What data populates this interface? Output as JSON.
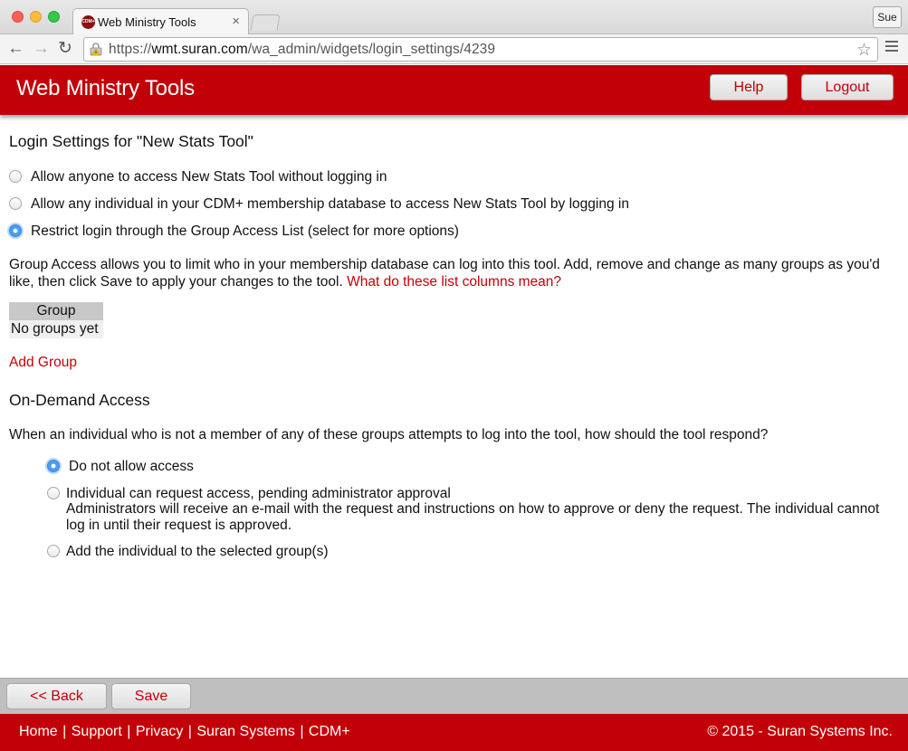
{
  "browser": {
    "tab_title": "Web Ministry Tools",
    "tab_close": "×",
    "favicon_text": "CDM+",
    "profile": "Sue",
    "url_scheme": "https://",
    "url_host": "wmt.suran.com",
    "url_path": "/wa_admin/widgets/login_settings/4239"
  },
  "header": {
    "title": "Web Ministry Tools",
    "help_label": "Help",
    "logout_label": "Logout"
  },
  "page": {
    "heading": "Login Settings for \"New Stats Tool\"",
    "login_options": [
      {
        "label": "Allow anyone to access New Stats Tool without logging in",
        "checked": false
      },
      {
        "label": "Allow any individual in your CDM+ membership database to access New Stats Tool by logging in",
        "checked": false
      },
      {
        "label": "Restrict login through the Group Access List (select for more options)",
        "checked": true
      }
    ],
    "group_access_desc": "Group Access allows you to limit who in your membership database can log into this tool. Add, remove and change as many groups as you'd like, then click Save to apply your changes to the tool.",
    "columns_link": "What do these list columns mean?",
    "table": {
      "header": "Group",
      "empty_row": "No groups yet"
    },
    "add_group": "Add Group",
    "on_demand_heading": "On-Demand Access",
    "on_demand_question": "When an individual who is not a member of any of these groups attempts to log into the tool, how should the tool respond?",
    "on_demand_options": [
      {
        "label": "Do not allow access",
        "checked": true
      },
      {
        "label": "Individual can request access, pending administrator approval",
        "checked": false
      },
      {
        "label": "Add the individual to the selected group(s)",
        "checked": false
      }
    ],
    "request_detail": "Administrators will receive an e-mail with the request and instructions on how to approve or deny the request. The individual cannot log in until their request is approved."
  },
  "actions": {
    "back_label": "<< Back",
    "save_label": "Save"
  },
  "footer": {
    "links": [
      "Home",
      "Support",
      "Privacy",
      "Suran Systems",
      "CDM+"
    ],
    "separator": "|",
    "copyright": "© 2015 - Suran Systems Inc."
  },
  "colors": {
    "brand_red": "#c20007",
    "radio_selected": "#4a9cf0"
  }
}
